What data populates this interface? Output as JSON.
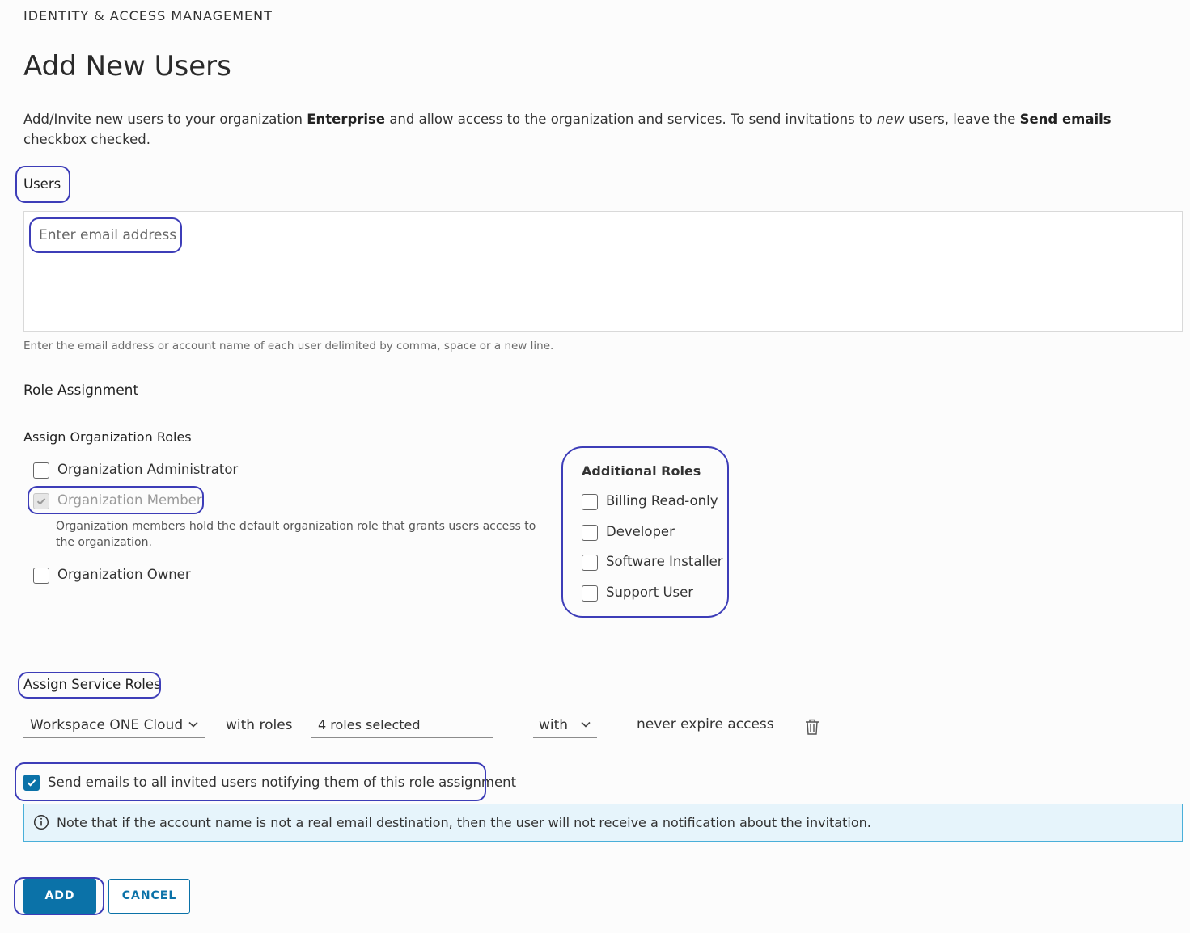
{
  "header": {
    "eyebrow": "IDENTITY & ACCESS MANAGEMENT",
    "title": "Add New Users"
  },
  "description": {
    "part1": "Add/Invite new users to your organization ",
    "org_name": "Enterprise",
    "part2": " and allow access to the organization and services. To send invitations to ",
    "new_word": "new",
    "part3": " users, leave the ",
    "send_emails": "Send emails",
    "part4": " checkbox checked."
  },
  "users": {
    "label": "Users",
    "placeholder": "Enter email address",
    "value": "",
    "hint": "Enter the email address or account name of each user delimited by comma, space or a new line."
  },
  "role_assignment": {
    "title": "Role Assignment",
    "org_roles_title": "Assign Organization Roles",
    "org_roles": [
      {
        "label": "Organization Administrator",
        "checked": false,
        "disabled": false
      },
      {
        "label": "Organization Member",
        "checked": true,
        "disabled": true,
        "help": "Organization members hold the default organization role that grants users access to the organization."
      },
      {
        "label": "Organization Owner",
        "checked": false,
        "disabled": false
      }
    ],
    "additional_title": "Additional Roles",
    "additional_roles": [
      {
        "label": "Billing Read-only",
        "checked": false
      },
      {
        "label": "Developer",
        "checked": false
      },
      {
        "label": "Software Installer",
        "checked": false
      },
      {
        "label": "Support User",
        "checked": false
      }
    ]
  },
  "service_roles": {
    "title": "Assign Service Roles",
    "service": "Workspace ONE Cloud",
    "with_roles_label": "with roles",
    "roles_value": "4 roles selected",
    "with_label": "with",
    "expiry": "never expire access",
    "delete_icon": "trash-icon"
  },
  "notify": {
    "checked": true,
    "label": "Send emails to all invited users notifying them of this role assignment"
  },
  "info": {
    "icon": "info-icon",
    "text": "Note that if the account name is not a real email destination, then the user will not receive a notification about the invitation."
  },
  "actions": {
    "add_label": "ADD",
    "cancel_label": "CANCEL"
  },
  "colors": {
    "primary": "#0b72a8",
    "highlight": "#3d3db8",
    "info_bg": "#e6f4fb",
    "info_border": "#49afd9"
  }
}
